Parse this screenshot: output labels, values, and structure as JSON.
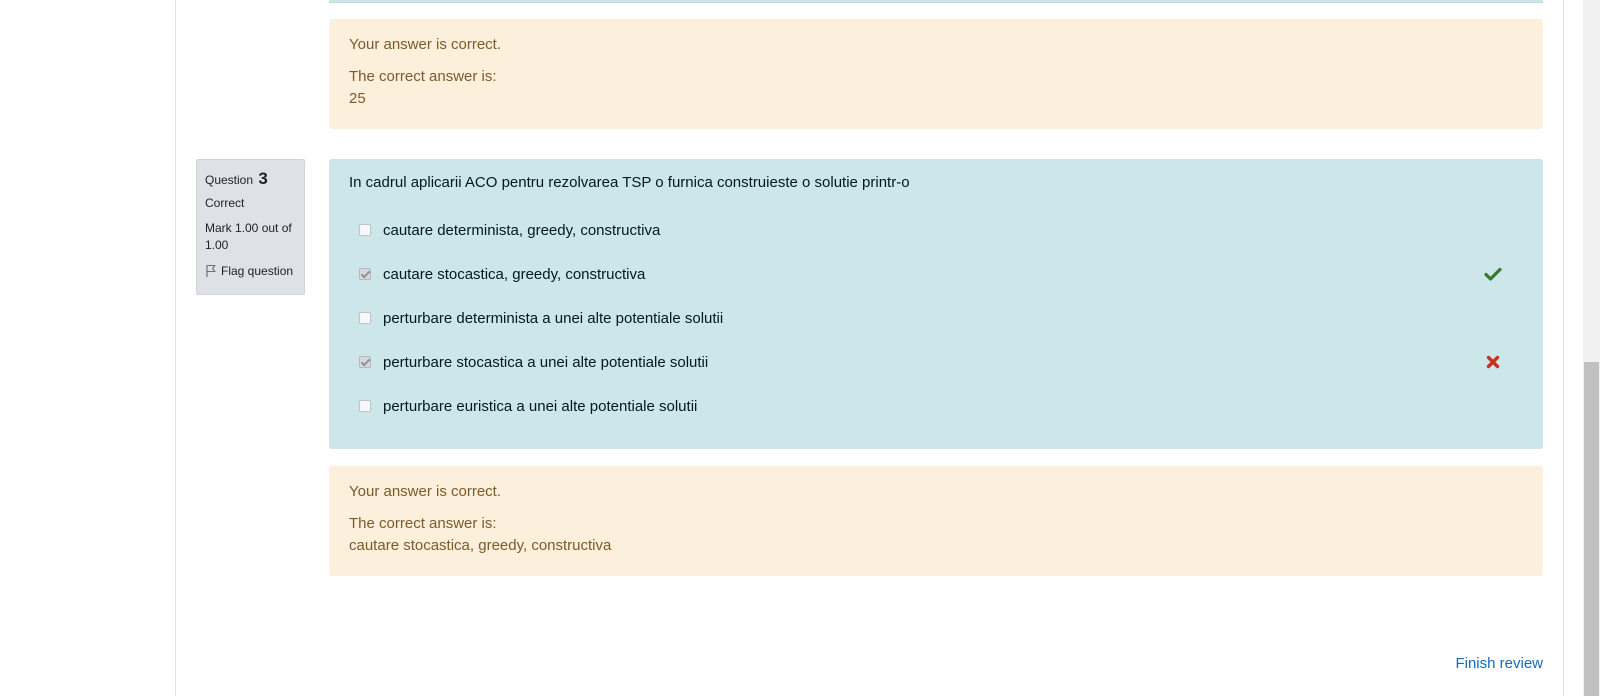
{
  "previous_question": {
    "feedback": {
      "general": "Your answer is correct.",
      "right_answer_label": "The correct answer is:",
      "right_answer_value": "25"
    }
  },
  "question": {
    "label": "Question",
    "number": "3",
    "state": "Correct",
    "grade": "Mark 1.00 out of 1.00",
    "flag_label": "Flag question",
    "text": "In cadrul aplicarii ACO pentru rezolvarea TSP o furnica construieste o solutie printr-o",
    "answers": [
      {
        "label": "cautare determinista, greedy, constructiva",
        "checked": false,
        "mark": ""
      },
      {
        "label": "cautare stocastica, greedy, constructiva",
        "checked": true,
        "mark": "correct"
      },
      {
        "label": "perturbare determinista a unei alte potentiale solutii",
        "checked": false,
        "mark": ""
      },
      {
        "label": "perturbare stocastica a unei alte potentiale solutii",
        "checked": true,
        "mark": "incorrect"
      },
      {
        "label": "perturbare euristica a unei alte potentiale solutii",
        "checked": false,
        "mark": ""
      }
    ],
    "feedback": {
      "general": "Your answer is correct.",
      "right_answer_label": "The correct answer is:",
      "right_answer_value": "cautare stocastica, greedy, constructiva"
    }
  },
  "footer": {
    "finish_review_label": "Finish review"
  },
  "colors": {
    "correct_icon": "#357a32",
    "incorrect_icon": "#ca3120",
    "link": "#0f6cbf",
    "qtext_bg": "#cce6ea",
    "feedback_bg": "#fcefdc"
  }
}
